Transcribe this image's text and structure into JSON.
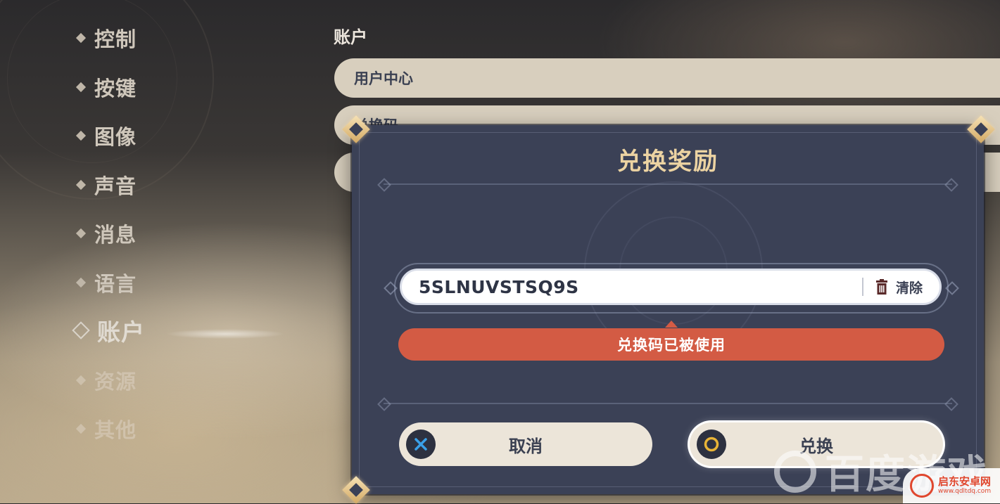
{
  "sidebar": {
    "items": [
      {
        "label": "控制"
      },
      {
        "label": "按键"
      },
      {
        "label": "图像"
      },
      {
        "label": "声音"
      },
      {
        "label": "消息"
      },
      {
        "label": "语言"
      },
      {
        "label": "账户"
      },
      {
        "label": "资源"
      },
      {
        "label": "其他"
      }
    ],
    "active": "账户"
  },
  "main": {
    "section_title": "账户",
    "rows": [
      {
        "label": "用户中心"
      },
      {
        "label": "兑换码"
      },
      {
        "label": ""
      }
    ]
  },
  "dialog": {
    "title": "兑换奖励",
    "code_input": {
      "value": "5SLNUVSTSQ9S"
    },
    "clear_label": "清除",
    "error_message": "兑换码已被使用",
    "cancel_label": "取消",
    "confirm_label": "兑换"
  },
  "watermarks": {
    "baidu": "百度游戏",
    "qidian_name": "启东安卓网",
    "qidian_url": "www.qdltdq.com"
  },
  "colors": {
    "dialog_bg": "#3b4156",
    "title_gold": "#ecd3a2",
    "error_red": "#d35b44",
    "button_cream": "#ece5d9",
    "cancel_icon_blue": "#3aa0e8",
    "confirm_icon_gold": "#e8b437"
  },
  "icons": [
    "cross-icon",
    "circle-icon",
    "trash-icon"
  ]
}
